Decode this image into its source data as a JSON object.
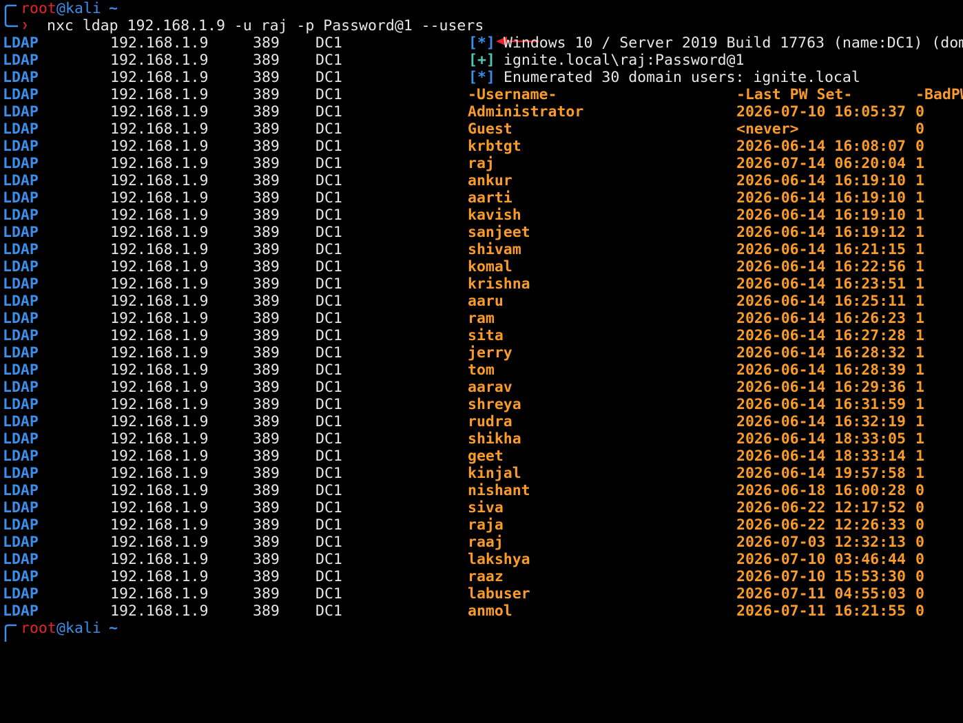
{
  "colors": {
    "background": "#000000",
    "protocol": "#3b8eea",
    "text": "#e8e8e8",
    "user_highlight": "#f99b2b",
    "prompt_user": "#e8232a",
    "status_info": "#3b8eea",
    "status_ok": "#4ec9b0"
  },
  "prompt": {
    "user": "root",
    "at": "@",
    "host": "kali",
    "cwd": "~",
    "command": "nxc ldap 192.168.1.9 -u raj -p Password@1 --users"
  },
  "header_lines": [
    {
      "protocol": "LDAP",
      "ip": "192.168.1.9",
      "port": "389",
      "host": "DC1",
      "marker": "[*]",
      "message": "Windows 10 / Server 2019 Build 17763 (name:DC1) (dom"
    },
    {
      "protocol": "LDAP",
      "ip": "192.168.1.9",
      "port": "389",
      "host": "DC1",
      "marker": "[+]",
      "message": "ignite.local\\raj:Password@1"
    },
    {
      "protocol": "LDAP",
      "ip": "192.168.1.9",
      "port": "389",
      "host": "DC1",
      "marker": "[*]",
      "message": "Enumerated 30 domain users: ignite.local"
    }
  ],
  "table_header": {
    "protocol": "LDAP",
    "ip": "192.168.1.9",
    "port": "389",
    "host": "DC1",
    "username": "-Username-",
    "last_pw_set": "-Last PW Set-",
    "badpw": "-BadPW"
  },
  "users": [
    {
      "username": "Administrator",
      "last_pw_set": "2026-07-10 16:05:37",
      "badpw": "0"
    },
    {
      "username": "Guest",
      "last_pw_set": "<never>",
      "badpw": "0"
    },
    {
      "username": "krbtgt",
      "last_pw_set": "2026-06-14 16:08:07",
      "badpw": "0"
    },
    {
      "username": "raj",
      "last_pw_set": "2026-07-14 06:20:04",
      "badpw": "1"
    },
    {
      "username": "ankur",
      "last_pw_set": "2026-06-14 16:19:10",
      "badpw": "1"
    },
    {
      "username": "aarti",
      "last_pw_set": "2026-06-14 16:19:10",
      "badpw": "1"
    },
    {
      "username": "kavish",
      "last_pw_set": "2026-06-14 16:19:10",
      "badpw": "1"
    },
    {
      "username": "sanjeet",
      "last_pw_set": "2026-06-14 16:19:12",
      "badpw": "1"
    },
    {
      "username": "shivam",
      "last_pw_set": "2026-06-14 16:21:15",
      "badpw": "1"
    },
    {
      "username": "komal",
      "last_pw_set": "2026-06-14 16:22:56",
      "badpw": "1"
    },
    {
      "username": "krishna",
      "last_pw_set": "2026-06-14 16:23:51",
      "badpw": "1"
    },
    {
      "username": "aaru",
      "last_pw_set": "2026-06-14 16:25:11",
      "badpw": "1"
    },
    {
      "username": "ram",
      "last_pw_set": "2026-06-14 16:26:23",
      "badpw": "1"
    },
    {
      "username": "sita",
      "last_pw_set": "2026-06-14 16:27:28",
      "badpw": "1"
    },
    {
      "username": "jerry",
      "last_pw_set": "2026-06-14 16:28:32",
      "badpw": "1"
    },
    {
      "username": "tom",
      "last_pw_set": "2026-06-14 16:28:39",
      "badpw": "1"
    },
    {
      "username": "aarav",
      "last_pw_set": "2026-06-14 16:29:36",
      "badpw": "1"
    },
    {
      "username": "shreya",
      "last_pw_set": "2026-06-14 16:31:59",
      "badpw": "1"
    },
    {
      "username": "rudra",
      "last_pw_set": "2026-06-14 16:32:19",
      "badpw": "1"
    },
    {
      "username": "shikha",
      "last_pw_set": "2026-06-14 18:33:05",
      "badpw": "1"
    },
    {
      "username": "geet",
      "last_pw_set": "2026-06-14 18:33:14",
      "badpw": "1"
    },
    {
      "username": "kinjal",
      "last_pw_set": "2026-06-14 19:57:58",
      "badpw": "1"
    },
    {
      "username": "nishant",
      "last_pw_set": "2026-06-18 16:00:28",
      "badpw": "0"
    },
    {
      "username": "siva",
      "last_pw_set": "2026-06-22 12:17:52",
      "badpw": "0"
    },
    {
      "username": "raja",
      "last_pw_set": "2026-06-22 12:26:33",
      "badpw": "0"
    },
    {
      "username": "raaj",
      "last_pw_set": "2026-07-03 12:32:13",
      "badpw": "0"
    },
    {
      "username": "lakshya",
      "last_pw_set": "2026-07-10 03:46:44",
      "badpw": "0"
    },
    {
      "username": "raaz",
      "last_pw_set": "2026-07-10 15:53:30",
      "badpw": "0"
    },
    {
      "username": "labuser",
      "last_pw_set": "2026-07-11 04:55:03",
      "badpw": "0"
    },
    {
      "username": "anmol",
      "last_pw_set": "2026-07-11 16:21:55",
      "badpw": "0"
    }
  ],
  "row_meta": {
    "protocol": "LDAP",
    "ip": "192.168.1.9",
    "port": "389",
    "host": "DC1"
  },
  "icons": {
    "annotation_arrow": "left-arrow-icon",
    "prompt_corner": "prompt-bracket-icon"
  }
}
